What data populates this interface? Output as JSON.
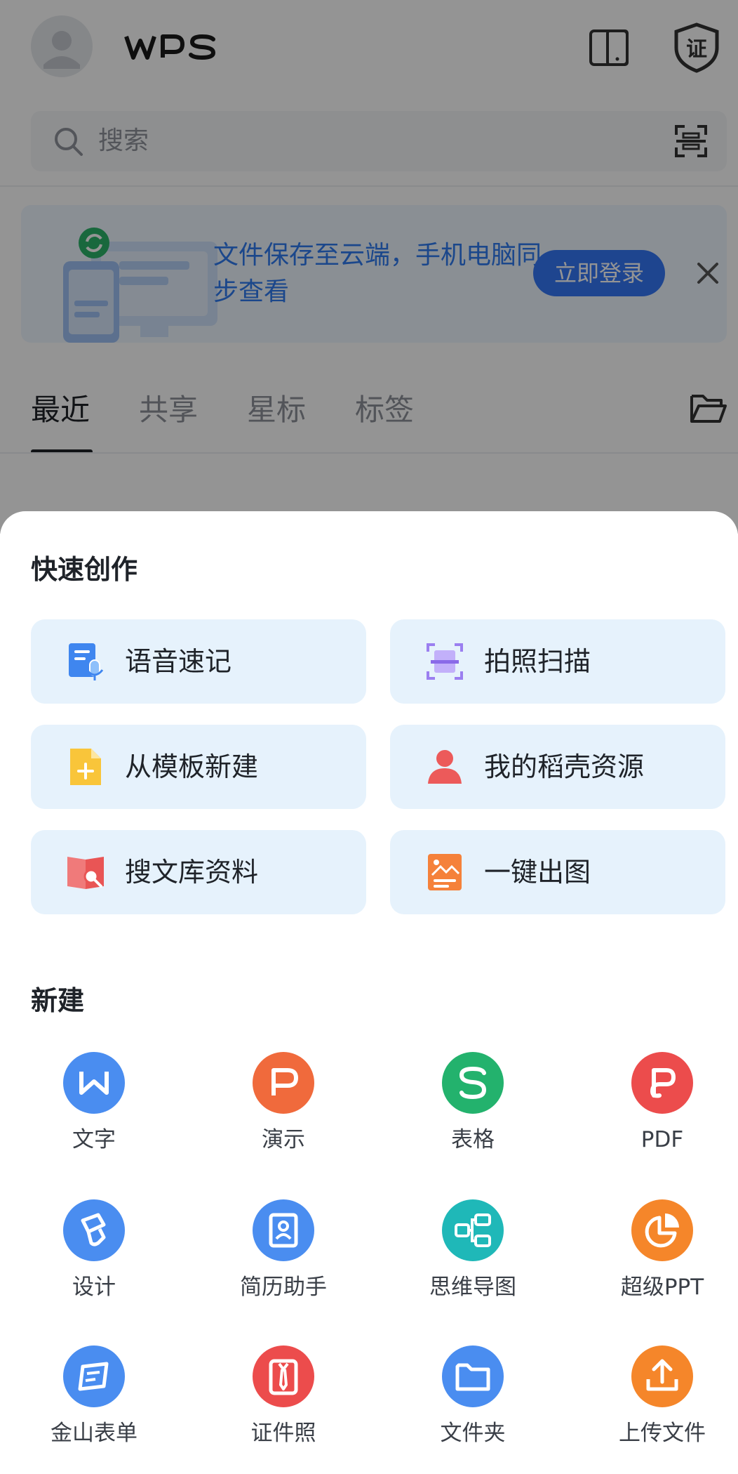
{
  "header": {
    "logo_text": "WPS",
    "search_placeholder": "搜索"
  },
  "banner": {
    "text": "文件保存至云端，手机电脑同步查看",
    "login_label": "立即登录"
  },
  "tabs": [
    {
      "label": "最近",
      "active": true
    },
    {
      "label": "共享",
      "active": false
    },
    {
      "label": "星标",
      "active": false
    },
    {
      "label": "标签",
      "active": false
    }
  ],
  "quick_create": {
    "title": "快速创作",
    "items": [
      {
        "label": "语音速记",
        "icon": "voice-note-icon"
      },
      {
        "label": "拍照扫描",
        "icon": "scan-document-icon"
      },
      {
        "label": "从模板新建",
        "icon": "template-new-icon"
      },
      {
        "label": "我的稻壳资源",
        "icon": "person-resource-icon"
      },
      {
        "label": "搜文库资料",
        "icon": "library-search-icon"
      },
      {
        "label": "一键出图",
        "icon": "image-generate-icon"
      }
    ]
  },
  "new_section": {
    "title": "新建",
    "items": [
      {
        "label": "文字",
        "icon": "writer-icon",
        "color": "#4a8df0"
      },
      {
        "label": "演示",
        "icon": "presentation-icon",
        "color": "#f06a3c"
      },
      {
        "label": "表格",
        "icon": "spreadsheet-icon",
        "color": "#23b26d"
      },
      {
        "label": "PDF",
        "icon": "pdf-icon",
        "color": "#ec4c4c"
      },
      {
        "label": "设计",
        "icon": "design-icon",
        "color": "#4a8df0"
      },
      {
        "label": "简历助手",
        "icon": "resume-icon",
        "color": "#4a8df0"
      },
      {
        "label": "思维导图",
        "icon": "mindmap-icon",
        "color": "#1fb8b8"
      },
      {
        "label": "超级PPT",
        "icon": "super-ppt-icon",
        "color": "#f5862a"
      },
      {
        "label": "金山表单",
        "icon": "form-icon",
        "color": "#4a8df0"
      },
      {
        "label": "证件照",
        "icon": "id-photo-icon",
        "color": "#ec4c4c"
      },
      {
        "label": "文件夹",
        "icon": "folder-icon",
        "color": "#4a8df0"
      },
      {
        "label": "上传文件",
        "icon": "upload-icon",
        "color": "#f5862a"
      }
    ]
  }
}
